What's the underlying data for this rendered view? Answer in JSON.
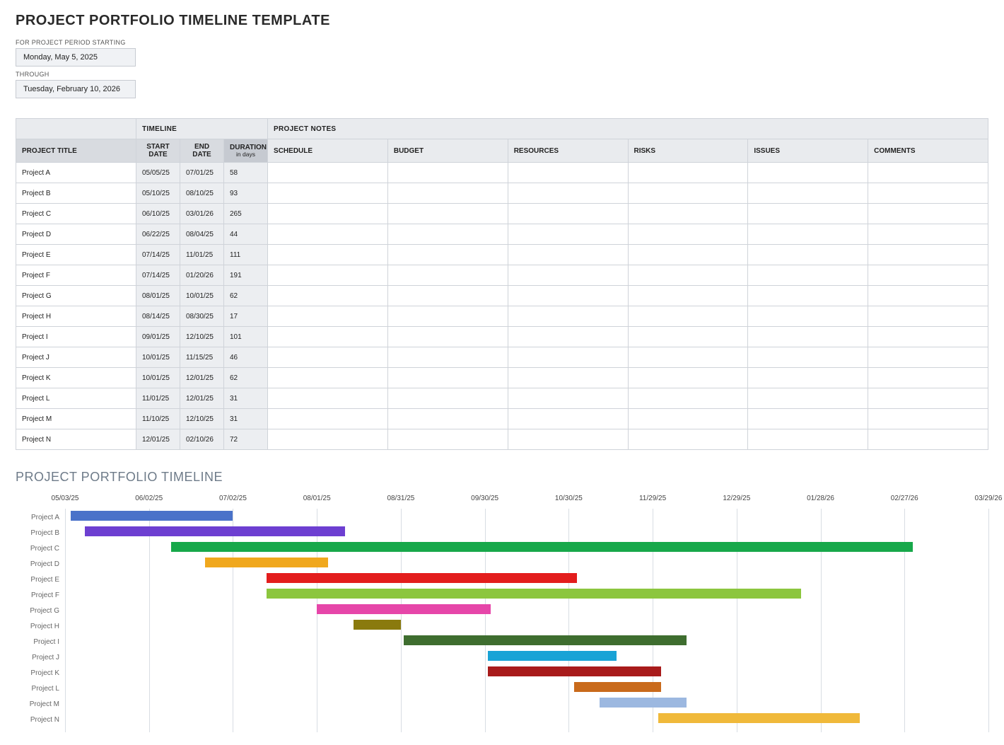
{
  "header": {
    "title": "PROJECT PORTFOLIO TIMELINE TEMPLATE",
    "period_start_label": "FOR PROJECT PERIOD STARTING",
    "period_start_value": "Monday, May 5, 2025",
    "through_label": "THROUGH",
    "period_end_value": "Tuesday, February 10, 2026"
  },
  "table": {
    "group_timeline": "TIMELINE",
    "group_notes": "PROJECT NOTES",
    "col_project_title": "PROJECT TITLE",
    "col_start": "START DATE",
    "col_end": "END DATE",
    "col_duration": "DURATION",
    "col_duration_sub": "in days",
    "notes_cols": [
      "SCHEDULE",
      "BUDGET",
      "RESOURCES",
      "RISKS",
      "ISSUES",
      "COMMENTS"
    ],
    "rows": [
      {
        "title": "Project A",
        "start": "05/05/25",
        "end": "07/01/25",
        "duration": "58"
      },
      {
        "title": "Project B",
        "start": "05/10/25",
        "end": "08/10/25",
        "duration": "93"
      },
      {
        "title": "Project C",
        "start": "06/10/25",
        "end": "03/01/26",
        "duration": "265"
      },
      {
        "title": "Project D",
        "start": "06/22/25",
        "end": "08/04/25",
        "duration": "44"
      },
      {
        "title": "Project E",
        "start": "07/14/25",
        "end": "11/01/25",
        "duration": "111"
      },
      {
        "title": "Project F",
        "start": "07/14/25",
        "end": "01/20/26",
        "duration": "191"
      },
      {
        "title": "Project G",
        "start": "08/01/25",
        "end": "10/01/25",
        "duration": "62"
      },
      {
        "title": "Project H",
        "start": "08/14/25",
        "end": "08/30/25",
        "duration": "17"
      },
      {
        "title": "Project I",
        "start": "09/01/25",
        "end": "12/10/25",
        "duration": "101"
      },
      {
        "title": "Project J",
        "start": "10/01/25",
        "end": "11/15/25",
        "duration": "46"
      },
      {
        "title": "Project K",
        "start": "10/01/25",
        "end": "12/01/25",
        "duration": "62"
      },
      {
        "title": "Project L",
        "start": "11/01/25",
        "end": "12/01/25",
        "duration": "31"
      },
      {
        "title": "Project M",
        "start": "11/10/25",
        "end": "12/10/25",
        "duration": "31"
      },
      {
        "title": "Project N",
        "start": "12/01/25",
        "end": "02/10/26",
        "duration": "72"
      }
    ]
  },
  "chart_data": {
    "type": "bar",
    "title": "PROJECT PORTFOLIO TIMELINE",
    "x_axis_ticks": [
      "05/03/25",
      "06/02/25",
      "07/02/25",
      "08/01/25",
      "08/31/25",
      "09/30/25",
      "10/30/25",
      "11/29/25",
      "12/29/25",
      "01/28/26",
      "02/27/26",
      "03/29/26"
    ],
    "x_range_days": {
      "start": "2025-05-03",
      "end": "2026-03-29",
      "total": 330
    },
    "categories": [
      "Project A",
      "Project B",
      "Project C",
      "Project D",
      "Project E",
      "Project F",
      "Project G",
      "Project H",
      "Project I",
      "Project J",
      "Project K",
      "Project L",
      "Project M",
      "Project N"
    ],
    "series": [
      {
        "name": "Project A",
        "start_offset_days": 2,
        "duration_days": 58,
        "color": "#4a72c9"
      },
      {
        "name": "Project B",
        "start_offset_days": 7,
        "duration_days": 93,
        "color": "#6d3fd1"
      },
      {
        "name": "Project C",
        "start_offset_days": 38,
        "duration_days": 265,
        "color": "#17a84a"
      },
      {
        "name": "Project D",
        "start_offset_days": 50,
        "duration_days": 44,
        "color": "#f0a81e"
      },
      {
        "name": "Project E",
        "start_offset_days": 72,
        "duration_days": 111,
        "color": "#e31d1d"
      },
      {
        "name": "Project F",
        "start_offset_days": 72,
        "duration_days": 191,
        "color": "#8cc63e"
      },
      {
        "name": "Project G",
        "start_offset_days": 90,
        "duration_days": 62,
        "color": "#e646a9"
      },
      {
        "name": "Project H",
        "start_offset_days": 103,
        "duration_days": 17,
        "color": "#8a7a0e"
      },
      {
        "name": "Project I",
        "start_offset_days": 121,
        "duration_days": 101,
        "color": "#3e6d2f"
      },
      {
        "name": "Project J",
        "start_offset_days": 151,
        "duration_days": 46,
        "color": "#19a3d6"
      },
      {
        "name": "Project K",
        "start_offset_days": 151,
        "duration_days": 62,
        "color": "#a81b1b"
      },
      {
        "name": "Project L",
        "start_offset_days": 182,
        "duration_days": 31,
        "color": "#c96a1b"
      },
      {
        "name": "Project M",
        "start_offset_days": 191,
        "duration_days": 31,
        "color": "#9cb8e0"
      },
      {
        "name": "Project N",
        "start_offset_days": 212,
        "duration_days": 72,
        "color": "#f0b93a"
      }
    ]
  }
}
